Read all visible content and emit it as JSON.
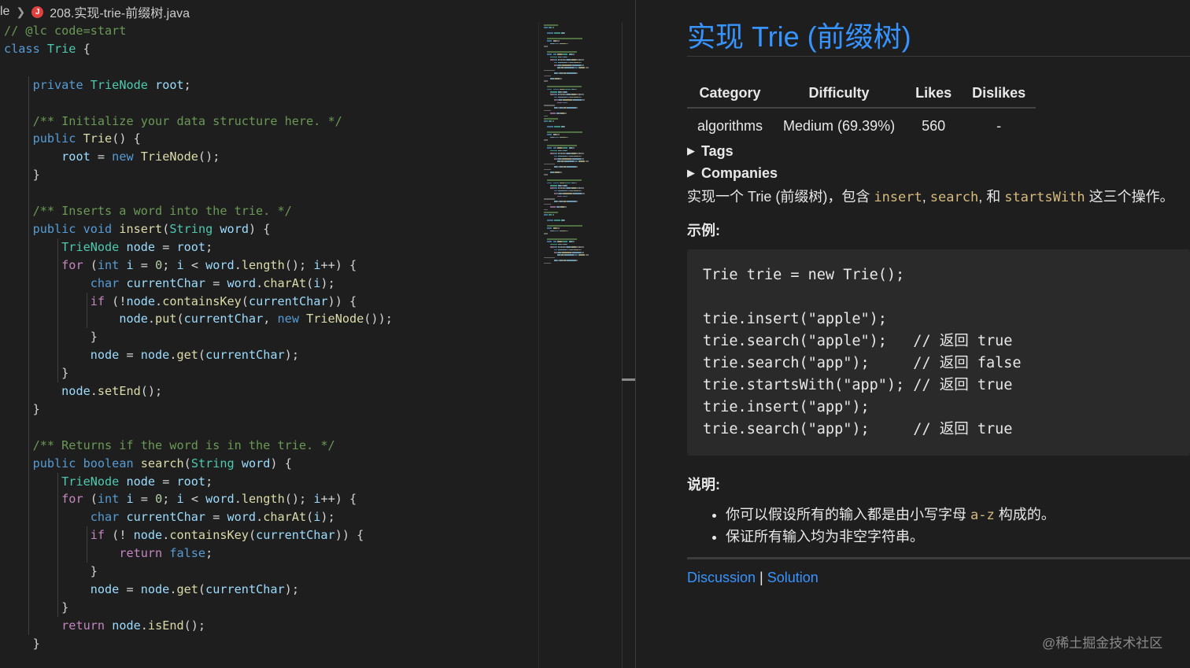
{
  "breadcrumb": {
    "prefix": "le",
    "file_icon": "java-error-icon",
    "file_icon_letter": "J",
    "filename": "208.实现-trie-前缀树.java"
  },
  "code_lines": [
    [
      [
        "cm",
        "// @lc code=start"
      ]
    ],
    [
      [
        "kw",
        "class"
      ],
      [
        "pl",
        " "
      ],
      [
        "ty",
        "Trie"
      ],
      [
        "pl",
        " {"
      ]
    ],
    [],
    [
      [
        "pl",
        "    "
      ],
      [
        "kw",
        "private"
      ],
      [
        "pl",
        " "
      ],
      [
        "ty",
        "TrieNode"
      ],
      [
        "pl",
        " "
      ],
      [
        "var",
        "root"
      ],
      [
        "pl",
        ";"
      ]
    ],
    [],
    [
      [
        "pl",
        "    "
      ],
      [
        "cm",
        "/** Initialize your data structure here. */"
      ]
    ],
    [
      [
        "pl",
        "    "
      ],
      [
        "kw",
        "public"
      ],
      [
        "pl",
        " "
      ],
      [
        "fn",
        "Trie"
      ],
      [
        "pl",
        "() {"
      ]
    ],
    [
      [
        "pl",
        "        "
      ],
      [
        "var",
        "root"
      ],
      [
        "pl",
        " = "
      ],
      [
        "kw",
        "new"
      ],
      [
        "pl",
        " "
      ],
      [
        "fn",
        "TrieNode"
      ],
      [
        "pl",
        "();"
      ]
    ],
    [
      [
        "pl",
        "    }"
      ]
    ],
    [],
    [
      [
        "pl",
        "    "
      ],
      [
        "cm",
        "/** Inserts a word into the trie. */"
      ]
    ],
    [
      [
        "pl",
        "    "
      ],
      [
        "kw",
        "public"
      ],
      [
        "pl",
        " "
      ],
      [
        "kw",
        "void"
      ],
      [
        "pl",
        " "
      ],
      [
        "fn",
        "insert"
      ],
      [
        "pl",
        "("
      ],
      [
        "ty",
        "String"
      ],
      [
        "pl",
        " "
      ],
      [
        "var",
        "word"
      ],
      [
        "pl",
        ") {"
      ]
    ],
    [
      [
        "pl",
        "        "
      ],
      [
        "ty",
        "TrieNode"
      ],
      [
        "pl",
        " "
      ],
      [
        "var",
        "node"
      ],
      [
        "pl",
        " = "
      ],
      [
        "var",
        "root"
      ],
      [
        "pl",
        ";"
      ]
    ],
    [
      [
        "pl",
        "        "
      ],
      [
        "kw2",
        "for"
      ],
      [
        "pl",
        " ("
      ],
      [
        "kw",
        "int"
      ],
      [
        "pl",
        " "
      ],
      [
        "var",
        "i"
      ],
      [
        "pl",
        " = "
      ],
      [
        "nm",
        "0"
      ],
      [
        "pl",
        "; "
      ],
      [
        "var",
        "i"
      ],
      [
        "pl",
        " < "
      ],
      [
        "var",
        "word"
      ],
      [
        "pl",
        "."
      ],
      [
        "fn",
        "length"
      ],
      [
        "pl",
        "(); "
      ],
      [
        "var",
        "i"
      ],
      [
        "pl",
        "++) {"
      ]
    ],
    [
      [
        "pl",
        "            "
      ],
      [
        "kw",
        "char"
      ],
      [
        "pl",
        " "
      ],
      [
        "var",
        "currentChar"
      ],
      [
        "pl",
        " = "
      ],
      [
        "var",
        "word"
      ],
      [
        "pl",
        "."
      ],
      [
        "fn",
        "charAt"
      ],
      [
        "pl",
        "("
      ],
      [
        "var",
        "i"
      ],
      [
        "pl",
        ");"
      ]
    ],
    [
      [
        "pl",
        "            "
      ],
      [
        "kw2",
        "if"
      ],
      [
        "pl",
        " (!"
      ],
      [
        "var",
        "node"
      ],
      [
        "pl",
        "."
      ],
      [
        "fn",
        "containsKey"
      ],
      [
        "pl",
        "("
      ],
      [
        "var",
        "currentChar"
      ],
      [
        "pl",
        ")) {"
      ]
    ],
    [
      [
        "pl",
        "                "
      ],
      [
        "var",
        "node"
      ],
      [
        "pl",
        "."
      ],
      [
        "fn",
        "put"
      ],
      [
        "pl",
        "("
      ],
      [
        "var",
        "currentChar"
      ],
      [
        "pl",
        ", "
      ],
      [
        "kw",
        "new"
      ],
      [
        "pl",
        " "
      ],
      [
        "fn",
        "TrieNode"
      ],
      [
        "pl",
        "());"
      ]
    ],
    [
      [
        "pl",
        "            }"
      ]
    ],
    [
      [
        "pl",
        "            "
      ],
      [
        "var",
        "node"
      ],
      [
        "pl",
        " = "
      ],
      [
        "var",
        "node"
      ],
      [
        "pl",
        "."
      ],
      [
        "fn",
        "get"
      ],
      [
        "pl",
        "("
      ],
      [
        "var",
        "currentChar"
      ],
      [
        "pl",
        ");"
      ]
    ],
    [
      [
        "pl",
        "        }"
      ]
    ],
    [
      [
        "pl",
        "        "
      ],
      [
        "var",
        "node"
      ],
      [
        "pl",
        "."
      ],
      [
        "fn",
        "setEnd"
      ],
      [
        "pl",
        "();"
      ]
    ],
    [
      [
        "pl",
        "    }"
      ]
    ],
    [],
    [
      [
        "pl",
        "    "
      ],
      [
        "cm",
        "/** Returns if the word is in the trie. */"
      ]
    ],
    [
      [
        "pl",
        "    "
      ],
      [
        "kw",
        "public"
      ],
      [
        "pl",
        " "
      ],
      [
        "kw",
        "boolean"
      ],
      [
        "pl",
        " "
      ],
      [
        "fn",
        "search"
      ],
      [
        "pl",
        "("
      ],
      [
        "ty",
        "String"
      ],
      [
        "pl",
        " "
      ],
      [
        "var",
        "word"
      ],
      [
        "pl",
        ") {"
      ]
    ],
    [
      [
        "pl",
        "        "
      ],
      [
        "ty",
        "TrieNode"
      ],
      [
        "pl",
        " "
      ],
      [
        "var",
        "node"
      ],
      [
        "pl",
        " = "
      ],
      [
        "var",
        "root"
      ],
      [
        "pl",
        ";"
      ]
    ],
    [
      [
        "pl",
        "        "
      ],
      [
        "kw2",
        "for"
      ],
      [
        "pl",
        " ("
      ],
      [
        "kw",
        "int"
      ],
      [
        "pl",
        " "
      ],
      [
        "var",
        "i"
      ],
      [
        "pl",
        " = "
      ],
      [
        "nm",
        "0"
      ],
      [
        "pl",
        "; "
      ],
      [
        "var",
        "i"
      ],
      [
        "pl",
        " < "
      ],
      [
        "var",
        "word"
      ],
      [
        "pl",
        "."
      ],
      [
        "fn",
        "length"
      ],
      [
        "pl",
        "(); "
      ],
      [
        "var",
        "i"
      ],
      [
        "pl",
        "++) {"
      ]
    ],
    [
      [
        "pl",
        "            "
      ],
      [
        "kw",
        "char"
      ],
      [
        "pl",
        " "
      ],
      [
        "var",
        "currentChar"
      ],
      [
        "pl",
        " = "
      ],
      [
        "var",
        "word"
      ],
      [
        "pl",
        "."
      ],
      [
        "fn",
        "charAt"
      ],
      [
        "pl",
        "("
      ],
      [
        "var",
        "i"
      ],
      [
        "pl",
        ");"
      ]
    ],
    [
      [
        "pl",
        "            "
      ],
      [
        "kw2",
        "if"
      ],
      [
        "pl",
        " (! "
      ],
      [
        "var",
        "node"
      ],
      [
        "pl",
        "."
      ],
      [
        "fn",
        "containsKey"
      ],
      [
        "pl",
        "("
      ],
      [
        "var",
        "currentChar"
      ],
      [
        "pl",
        ")) {"
      ]
    ],
    [
      [
        "pl",
        "                "
      ],
      [
        "kw2",
        "return"
      ],
      [
        "pl",
        " "
      ],
      [
        "kw",
        "false"
      ],
      [
        "pl",
        ";"
      ]
    ],
    [
      [
        "pl",
        "            }"
      ]
    ],
    [
      [
        "pl",
        "            "
      ],
      [
        "var",
        "node"
      ],
      [
        "pl",
        " = "
      ],
      [
        "var",
        "node"
      ],
      [
        "pl",
        "."
      ],
      [
        "fn",
        "get"
      ],
      [
        "pl",
        "("
      ],
      [
        "var",
        "currentChar"
      ],
      [
        "pl",
        ");"
      ]
    ],
    [
      [
        "pl",
        "        }"
      ]
    ],
    [
      [
        "pl",
        "        "
      ],
      [
        "kw2",
        "return"
      ],
      [
        "pl",
        " "
      ],
      [
        "var",
        "node"
      ],
      [
        "pl",
        "."
      ],
      [
        "fn",
        "isEnd"
      ],
      [
        "pl",
        "();"
      ]
    ],
    [
      [
        "pl",
        "    }"
      ]
    ]
  ],
  "colors": {
    "keyword": "#569cd6",
    "control": "#c586c0",
    "type": "#4ec9b0",
    "function": "#dcdcaa",
    "variable": "#9cdcfe",
    "comment": "#6a9955",
    "number": "#b5cea8",
    "link": "#3794ff",
    "inline_code": "#d7ba7d"
  },
  "problem": {
    "title": "实现 Trie (前缀树)",
    "table": {
      "headers": [
        "Category",
        "Difficulty",
        "Likes",
        "Dislikes"
      ],
      "row": [
        "algorithms",
        "Medium (69.39%)",
        "560",
        "-"
      ]
    },
    "tags_label": "Tags",
    "companies_label": "Companies",
    "desc_prefix": "实现一个 Trie (前缀树)，包含 ",
    "desc_code1": "insert",
    "desc_sep1": ", ",
    "desc_code2": "search",
    "desc_sep2": ", 和 ",
    "desc_code3": "startsWith",
    "desc_suffix": " 这三个操作。",
    "example_heading": "示例:",
    "example_lines": [
      "Trie trie = new Trie();",
      "",
      "trie.insert(\"apple\");",
      "trie.search(\"apple\");   // 返回 true",
      "trie.search(\"app\");     // 返回 false",
      "trie.startsWith(\"app\"); // 返回 true",
      "trie.insert(\"app\");",
      "trie.search(\"app\");     // 返回 true"
    ],
    "note_heading": "说明:",
    "note1_prefix": "你可以假设所有的输入都是由小写字母 ",
    "note1_code": "a-z",
    "note1_suffix": " 构成的。",
    "note2": "保证所有输入均为非空字符串。",
    "discussion_label": "Discussion",
    "link_sep": " | ",
    "solution_label": "Solution"
  },
  "watermark": "@稀土掘金技术社区"
}
